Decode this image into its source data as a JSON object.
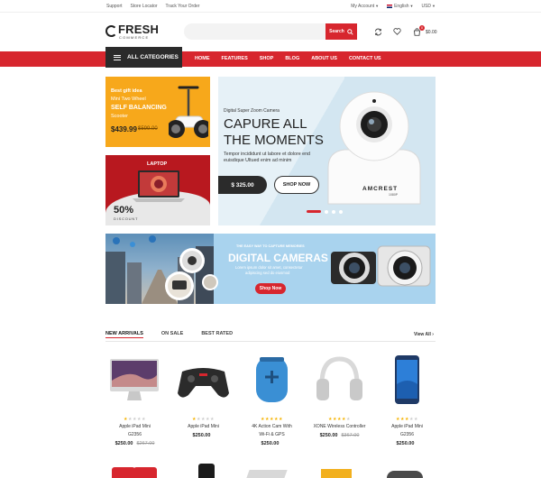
{
  "topbar": {
    "links": [
      "Support",
      "Store Locator",
      "Track Your Order"
    ],
    "account": "My Account",
    "language": "English",
    "currency": "USD"
  },
  "logo": {
    "name": "FRESH",
    "sub": "COMMERCE"
  },
  "search": {
    "placeholder": "",
    "button_label": "Search"
  },
  "cart": {
    "count": "0",
    "total": "$0.00"
  },
  "nav": {
    "categories_label": "ALL CATEGORIES",
    "links": [
      "HOME",
      "FEATURES",
      "SHOP",
      "BLOG",
      "ABOUT US",
      "CONTACT US"
    ]
  },
  "promo_scooter": {
    "line1": "Best gift idea",
    "line2": "Mini Two Wheel",
    "headline": "SELF BALANCING",
    "line3": "Scooter",
    "price": "$439.99",
    "old_price": "$599.00"
  },
  "promo_laptop": {
    "title": "LAPTOP",
    "percent": "50%",
    "discount": "DISCOUNT"
  },
  "hero": {
    "eyebrow": "Digital Super Zoom Camera",
    "title_line1": "CAPURE ALL",
    "title_line2": "THE MOMENTS",
    "body_line1": "Tempor incididunt ut labore et dolore  end",
    "body_line2": "euisdique Ultued enim ad minim",
    "price": "$ 325.00",
    "button_label": "SHOP NOW",
    "brand": "AMCREST",
    "brand_sub": "1080P"
  },
  "camera_banner": {
    "eyebrow": "THE EASY WAY TO CAPTURE MEMORIES",
    "title": "DIGITAL CAMERAS",
    "body_line1": "Lorem ipsum dolor sit amet, consectetur",
    "body_line2": "adipiscing sed do eiusmod",
    "button_label": "Shop Now"
  },
  "tabs": [
    "NEW ARRIVALS",
    "ON SALE",
    "BEST RATED"
  ],
  "view_all": "View All",
  "products": [
    {
      "name_line1": "Apple iPad Mini",
      "name_line2": "G2356",
      "price": "$250.00",
      "old_price": "$267.00",
      "rating": 1,
      "icon": "imac-icon"
    },
    {
      "name_line1": "Apple iPad Mini",
      "name_line2": "",
      "price": "$250.00",
      "old_price": "",
      "rating": 1,
      "icon": "gamepad-icon"
    },
    {
      "name_line1": "4K Action Cam With",
      "name_line2": "Wi-Fi & GPS",
      "price": "$250.00",
      "old_price": "",
      "rating": 5,
      "icon": "speaker-icon"
    },
    {
      "name_line1": "XONE Wireless Controller",
      "name_line2": "",
      "price": "$250.00",
      "old_price": "$367.00",
      "rating": 4,
      "icon": "headphones-icon"
    },
    {
      "name_line1": "Apple iPad Mini",
      "name_line2": "G2356",
      "price": "$250.00",
      "old_price": "",
      "rating": 3,
      "icon": "smartphone-icon"
    }
  ],
  "colors": {
    "accent": "#d7262e",
    "dark": "#2b2b2b",
    "star": "#f5b301"
  }
}
